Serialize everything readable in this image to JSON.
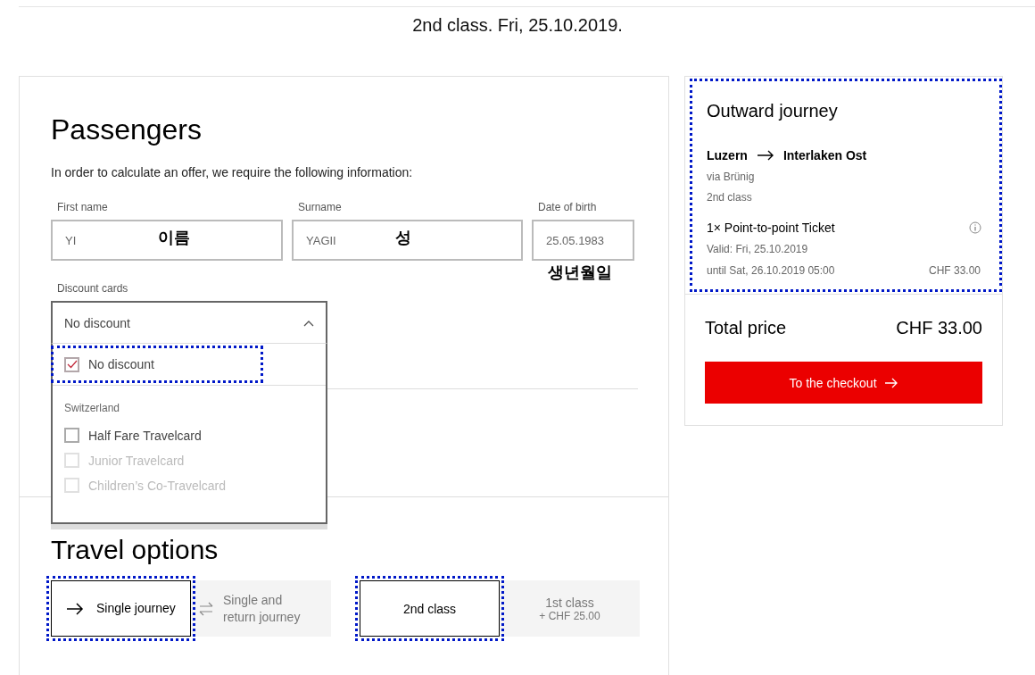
{
  "header": {
    "subtitle": "2nd class. Fri, 25.10.2019."
  },
  "passengers": {
    "title": "Passengers",
    "intro": "In order to calculate an offer, we require the following information:",
    "fields": [
      {
        "label": "First name",
        "value": "YI",
        "annotation": "이름"
      },
      {
        "label": "Surname",
        "value": "YAGII",
        "annotation": "성"
      },
      {
        "label": "Date of birth",
        "value": "25.05.1983",
        "annotation": "생년월일"
      }
    ],
    "discount": {
      "label": "Discount cards",
      "value": "No discount",
      "expanded": true,
      "options": [
        {
          "kind": "option",
          "label": "No discount",
          "checked": true,
          "disabled": false,
          "highlighted": true
        },
        {
          "kind": "group",
          "label": "Switzerland"
        },
        {
          "kind": "option",
          "label": "Half Fare Travelcard",
          "checked": false,
          "disabled": false,
          "highlighted": false
        },
        {
          "kind": "option",
          "label": "Junior Travelcard",
          "checked": false,
          "disabled": true,
          "highlighted": false
        },
        {
          "kind": "option",
          "label": "Children’s Co-Travelcard",
          "checked": false,
          "disabled": true,
          "highlighted": false
        }
      ]
    }
  },
  "travel_options": {
    "title": "Travel options",
    "journey": [
      {
        "kind": "one-way",
        "label": "Single journey",
        "selected": true,
        "highlighted": true
      },
      {
        "kind": "round-trip",
        "label": "Single and return journey",
        "selected": false,
        "highlighted": false
      }
    ],
    "class": [
      {
        "label": "2nd class",
        "selected": true,
        "highlighted": true
      },
      {
        "label": "1st class",
        "note": "+ CHF 25.00",
        "selected": false,
        "highlighted": false
      }
    ]
  },
  "summary": {
    "title": "Outward journey",
    "highlighted": true,
    "from": "Luzern",
    "to": "Interlaken Ost",
    "via": "via Brünig",
    "class": "2nd class",
    "ticket": "1× Point-to-point Ticket",
    "valid": "Valid: Fri, 25.10.2019",
    "until": "until Sat, 26.10.2019 05:00",
    "price": "CHF 33.00",
    "total_label": "Total price",
    "total_value": "CHF 33.00",
    "checkout": "To the checkout"
  }
}
